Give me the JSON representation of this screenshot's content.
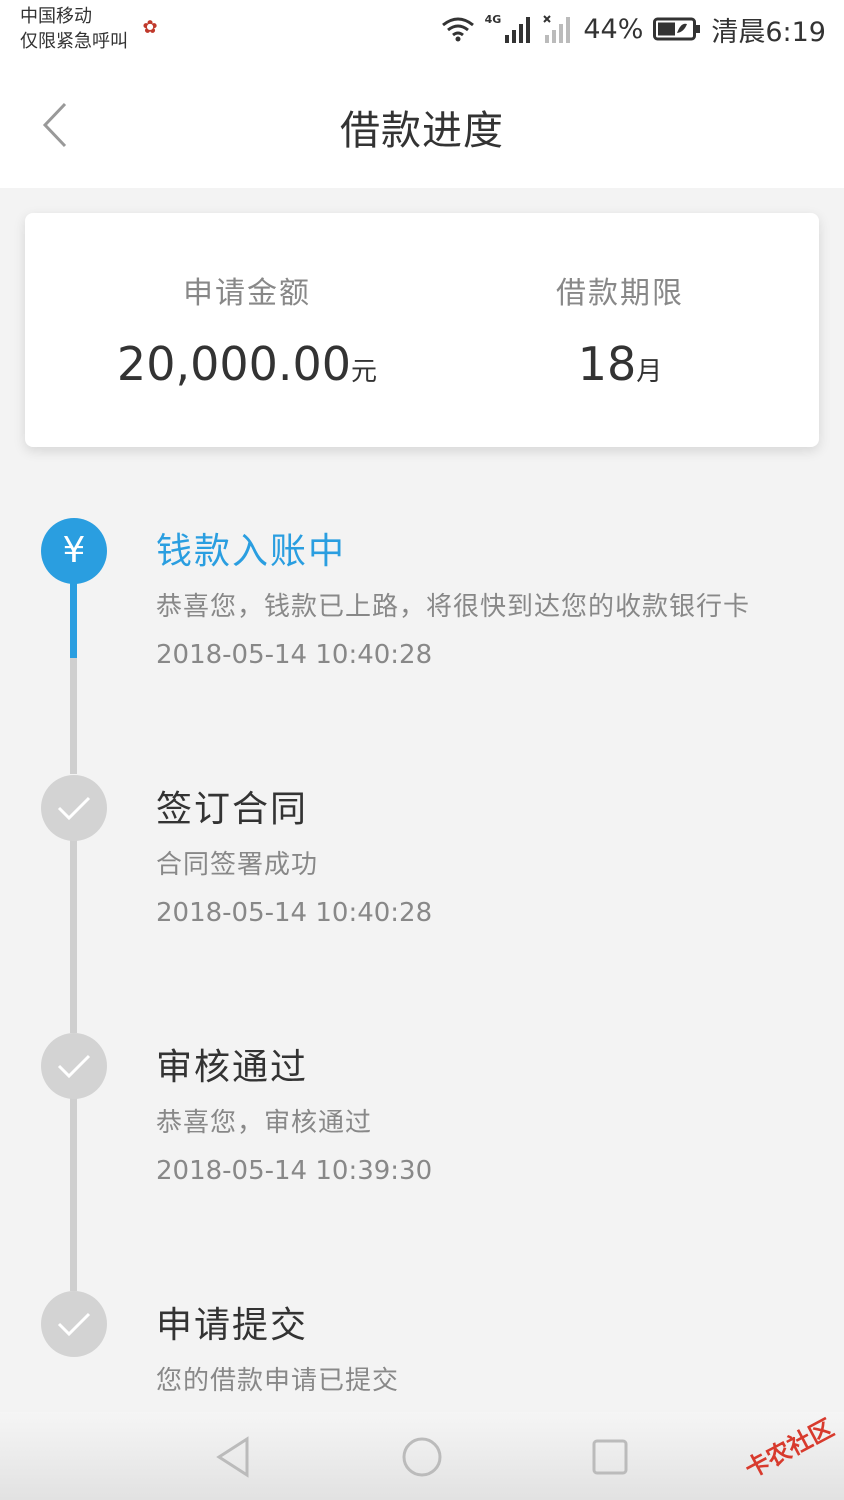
{
  "status_bar": {
    "carrier_line1": "中国移动",
    "carrier_line2": "仅限紧急呼叫",
    "network_tag": "4G",
    "battery_percent": "44%",
    "time": "清晨6:19",
    "icons": [
      "wifi-icon",
      "signal-icon",
      "no-signal-icon",
      "battery-icon"
    ]
  },
  "nav": {
    "back_icon": "chevron-left-icon",
    "title": "借款进度"
  },
  "summary": {
    "amount_label": "申请金额",
    "amount_value": "20,000.00",
    "amount_unit": "元",
    "term_label": "借款期限",
    "term_value": "18",
    "term_unit": "月"
  },
  "timeline": {
    "steps": [
      {
        "title": "钱款入账中",
        "desc": "恭喜您，钱款已上路，将很快到达您的收款银行卡",
        "time": "2018-05-14 10:40:28",
        "status": "current",
        "icon": "yuan-icon",
        "icon_glyph": "¥"
      },
      {
        "title": "签订合同",
        "desc": "合同签署成功",
        "time": "2018-05-14 10:40:28",
        "status": "done",
        "icon": "check-icon"
      },
      {
        "title": "审核通过",
        "desc": "恭喜您，审核通过",
        "time": "2018-05-14 10:39:30",
        "status": "done",
        "icon": "check-icon"
      },
      {
        "title": "申请提交",
        "desc": "您的借款申请已提交",
        "status": "done",
        "icon": "check-icon"
      }
    ]
  },
  "system_nav": {
    "icons": [
      "back-triangle-icon",
      "home-circle-icon",
      "recents-square-icon"
    ]
  },
  "watermark": {
    "text": "卡农社区"
  },
  "colors": {
    "accent": "#2a9ee0",
    "background": "#f3f3f3",
    "card": "#ffffff",
    "text_primary": "#333333",
    "text_secondary": "#888888",
    "done_node": "#d3d3d3"
  }
}
